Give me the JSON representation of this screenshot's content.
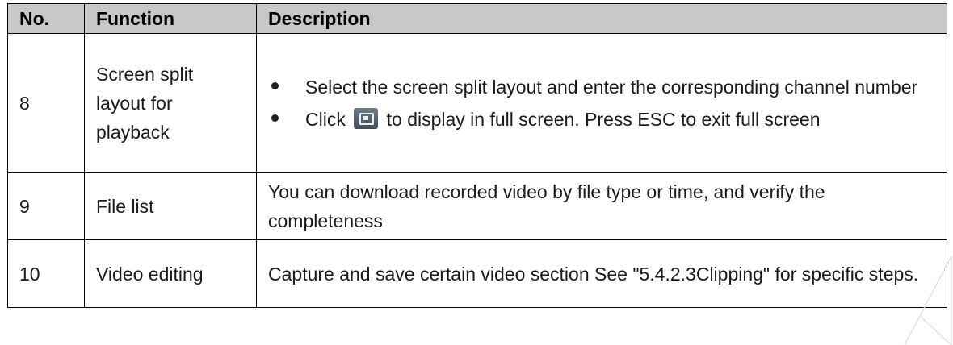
{
  "table": {
    "headers": {
      "no": "No.",
      "function": "Function",
      "description": "Description"
    },
    "rows": [
      {
        "no": "8",
        "function_lines": [
          "Screen split",
          "layout for",
          "playback"
        ],
        "bullets": [
          "Select the screen split layout and enter the corresponding channel number",
          {
            "before_icon": "Click",
            "icon": "fullscreen-icon",
            "after_icon": "to display in full screen. Press ESC to exit full screen"
          }
        ]
      },
      {
        "no": "9",
        "function": "File list",
        "description": "You can download recorded video by file type or time, and verify the completeness"
      },
      {
        "no": "10",
        "function": "Video editing",
        "description": "Capture and save certain video section See \"5.4.2.3Clipping\" for specific steps."
      }
    ]
  }
}
